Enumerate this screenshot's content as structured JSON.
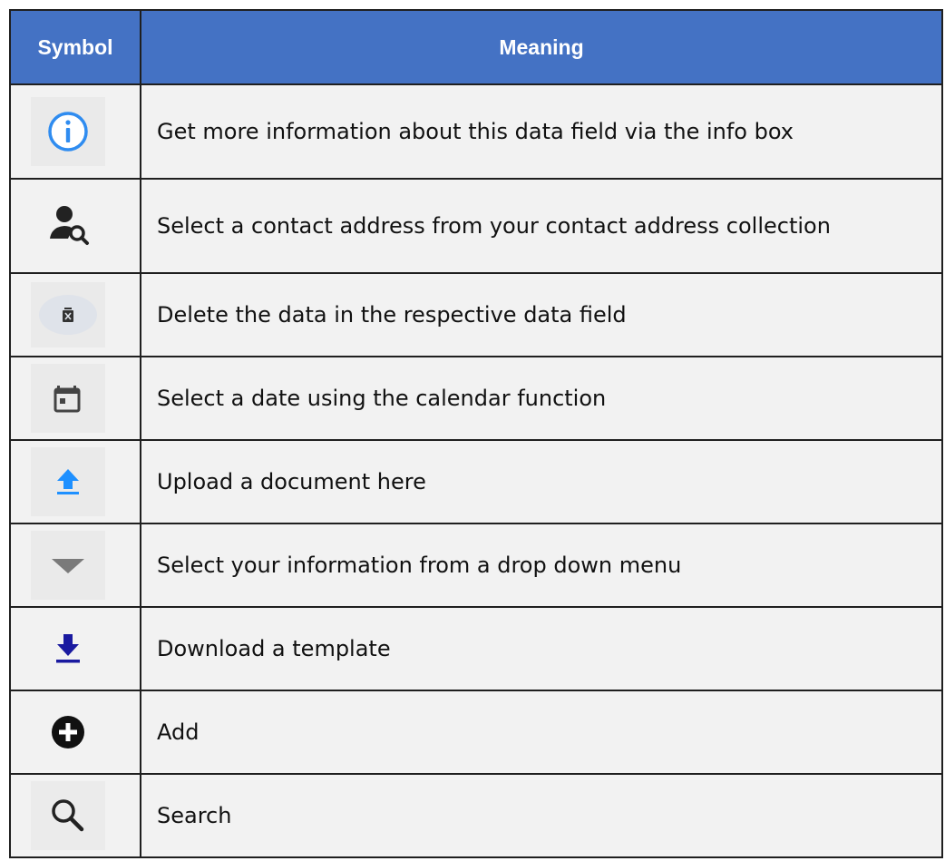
{
  "table": {
    "headers": {
      "symbol": "Symbol",
      "meaning": "Meaning"
    },
    "rows": [
      {
        "icon": "info-icon",
        "meaning": "Get more information about this data field via the info box"
      },
      {
        "icon": "contact-search-icon",
        "meaning": "Select a contact address from your contact address collection"
      },
      {
        "icon": "delete-icon",
        "meaning": "Delete the data in the respective data field"
      },
      {
        "icon": "calendar-icon",
        "meaning": "Select a date using the calendar function"
      },
      {
        "icon": "upload-icon",
        "meaning": "Upload a document here"
      },
      {
        "icon": "dropdown-arrow-icon",
        "meaning": "Select your information from a drop down menu"
      },
      {
        "icon": "download-icon",
        "meaning": "Download a template"
      },
      {
        "icon": "add-icon",
        "meaning": "Add"
      },
      {
        "icon": "search-icon",
        "meaning": "Search"
      }
    ]
  },
  "colors": {
    "header_bg": "#4472c4",
    "header_text": "#ffffff",
    "row_bg": "#f2f2f2",
    "border": "#1f1f1f",
    "info_blue": "#2f8cf0",
    "upload_blue": "#1e90ff",
    "download_navy": "#1a1aa0"
  }
}
